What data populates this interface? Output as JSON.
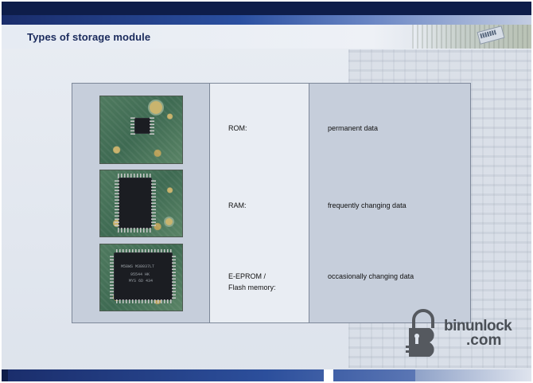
{
  "slide": {
    "title": "Types of storage module"
  },
  "table": {
    "rows": [
      {
        "type": "ROM:",
        "description": "permanent data",
        "image_icon": "soic-8-chip-photo"
      },
      {
        "type": "RAM:",
        "description": "frequently changing data",
        "image_icon": "soic-28-chip-photo"
      },
      {
        "type_line1": "E-EPROM /",
        "type_line2": "Flash memory:",
        "description": "occasionally changing data",
        "image_icon": "qfp-chip-photo"
      }
    ]
  },
  "chip_markings": {
    "row3_line1": "M58WS M38037LT",
    "row3_line2": "95544 HK",
    "row3_line3": "MYS 6D 434"
  },
  "watermark": {
    "line1": "binunlock",
    "line2": ".com"
  },
  "colors": {
    "title": "#1a2a5c",
    "top_bar": "#0e1d4a",
    "table_shaded": "#c6cedb",
    "table_light": "#e9edf3"
  }
}
